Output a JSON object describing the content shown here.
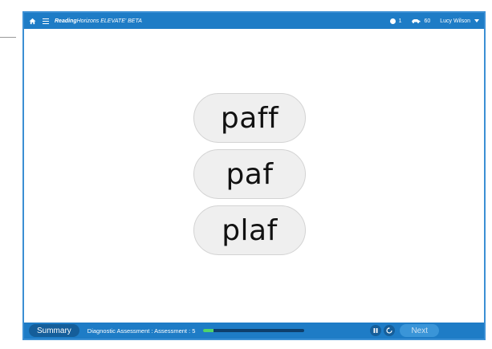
{
  "topbar": {
    "brand_reading": "Reading",
    "brand_horizons": "Horizons",
    "brand_product": "ELEVATE' BETA",
    "points_count": "1",
    "cars_count": "60",
    "user_name": "Lucy Wilson",
    "icons": {
      "home": "home-icon",
      "menu": "hamburger-menu-icon",
      "points": "circle-points-icon",
      "cars": "car-icon",
      "dropdown": "chevron-down-icon"
    }
  },
  "choices": [
    {
      "word": "paff"
    },
    {
      "word": "paf"
    },
    {
      "word": "plaf"
    }
  ],
  "bottombar": {
    "summary_label": "Summary",
    "assessment_label": "Diagnostic Assessment : Assessment : 5",
    "progress_fraction": 0.1,
    "next_label": "Next",
    "icons": {
      "pause": "pause-icon",
      "replay": "replay-icon"
    }
  },
  "colors": {
    "bar_blue": "#1e7cc6",
    "frame_border": "#3b8fd4",
    "progress_fill": "#4fd36a",
    "choice_bg": "#efefef"
  }
}
